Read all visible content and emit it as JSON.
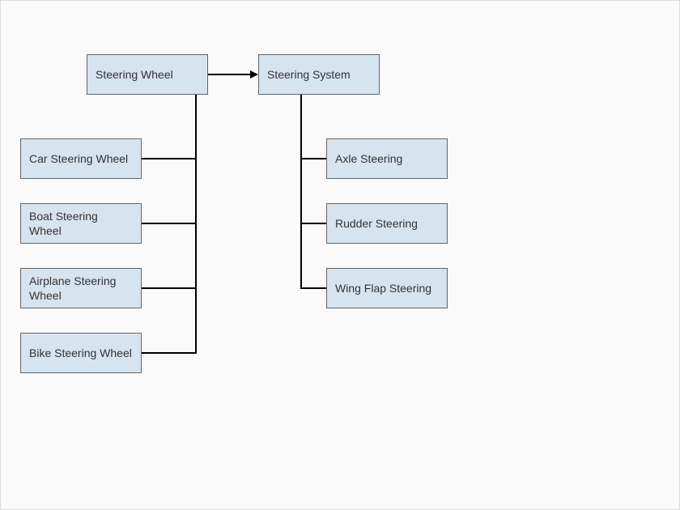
{
  "diagram": {
    "left_parent": "Steering Wheel",
    "right_parent": "Steering System",
    "left_children": [
      "Car Steering Wheel",
      "Boat Steering Wheel",
      "Airplane Steering Wheel",
      "Bike Steering Wheel"
    ],
    "right_children": [
      "Axle Steering",
      "Rudder Steering",
      "Wing Flap Steering"
    ]
  }
}
